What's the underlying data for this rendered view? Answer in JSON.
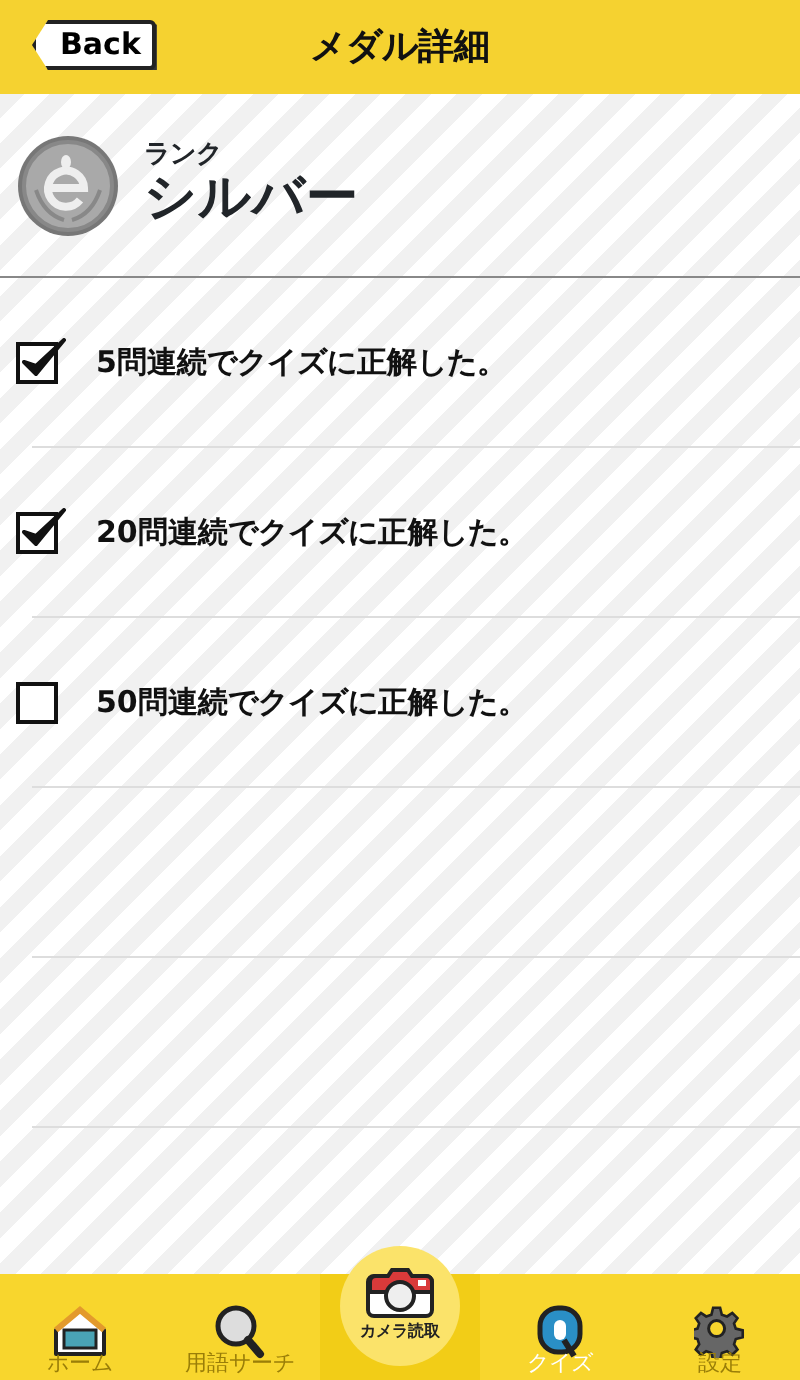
{
  "header": {
    "back_button": "Back",
    "title": "メダル詳細"
  },
  "rank": {
    "label": "ランク",
    "value": "シルバー"
  },
  "conditions": [
    {
      "text": "5問連続でクイズに正解した。",
      "checked": true
    },
    {
      "text": "20問連続でクイズに正解した。",
      "checked": true
    },
    {
      "text": "50問連続でクイズに正解した。",
      "checked": false
    }
  ],
  "tab_bar": [
    {
      "kind": "home",
      "label": "ホーム",
      "selected": false
    },
    {
      "kind": "search",
      "label": "用語サーチ",
      "selected": false
    },
    {
      "kind": "camera",
      "label": "カメラ読取",
      "selected": false
    },
    {
      "kind": "quiz",
      "label": "クイズ",
      "selected": true
    },
    {
      "kind": "settings",
      "label": "設定",
      "selected": false
    }
  ]
}
